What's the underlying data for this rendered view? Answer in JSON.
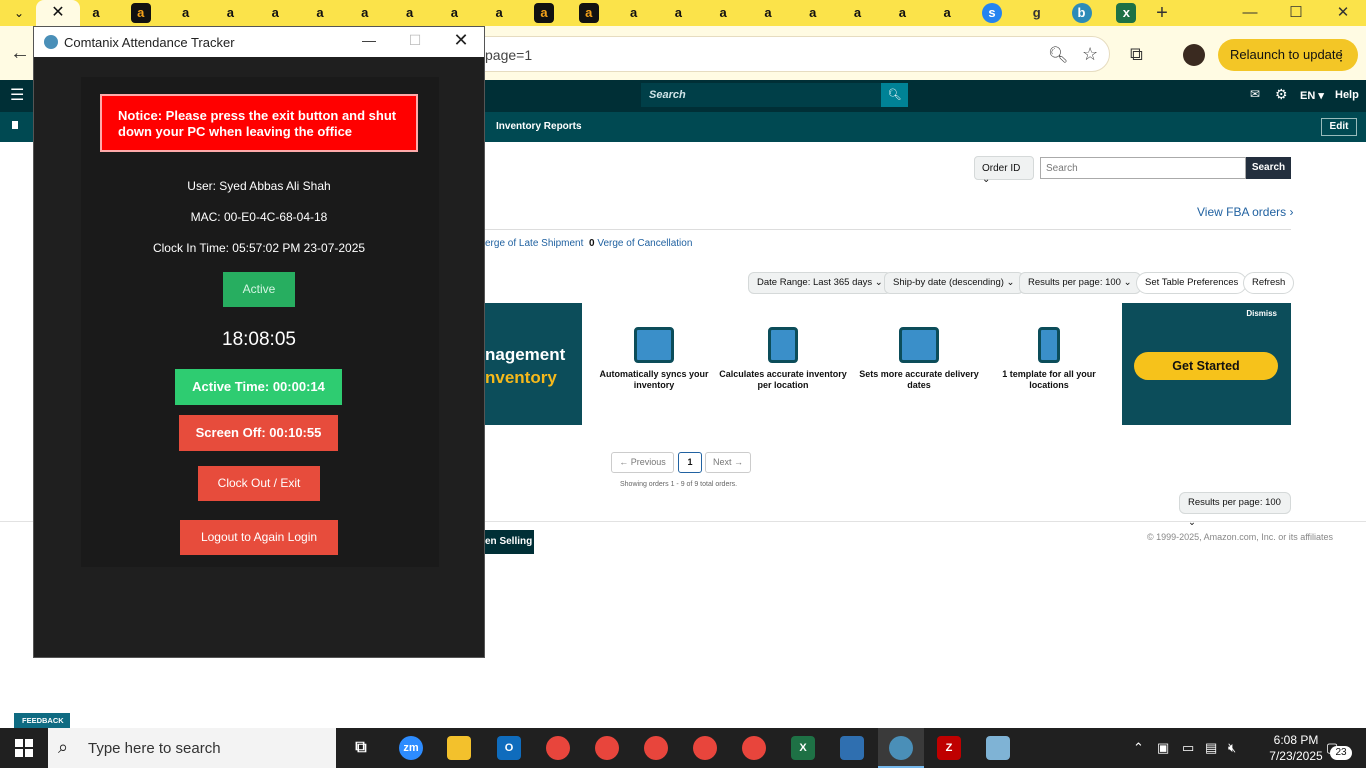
{
  "browser": {
    "tab_dropdown": "⌄",
    "active_tab_close": "✕",
    "tab_icons": [
      "a",
      "a",
      "a",
      "a",
      "a",
      "a",
      "a",
      "a",
      "a",
      "a",
      "a",
      "a",
      "a",
      "a",
      "a",
      "a",
      "a",
      "a",
      "a",
      "a",
      "s",
      "g",
      "b",
      "x"
    ],
    "new_tab": "+",
    "url_fragment": "page=1",
    "relaunch_label": "Relaunch to update",
    "window_controls": {
      "minimize": "—",
      "maximize": "☐",
      "close": "✕"
    }
  },
  "seller_central": {
    "search_placeholder": "Search",
    "lang": "EN ▾",
    "help": "Help",
    "subnav_item": "Inventory Reports",
    "edit": "Edit",
    "order_id_select": "Order ID ⌄",
    "order_search_placeholder": "Search",
    "order_search_button": "Search",
    "view_fba_orders": "View FBA orders ›",
    "late_shipment": "erge of Late Shipment",
    "cancellation_count": "0",
    "cancellation_label": " Verge of Cancellation",
    "filters": {
      "date_range": "Date Range: Last 365 days ⌄",
      "sort": "Ship-by date (descending) ⌄",
      "results_per_page": "Results per page: 100 ⌄",
      "table_prefs": "Set Table Preferences",
      "refresh": "Refresh"
    },
    "banner": {
      "title_line1": "nagement",
      "title_line2": "nventory",
      "features": [
        {
          "text": "Automatically syncs your inventory",
          "icon": "barcode-scanner-icon"
        },
        {
          "text": "Calculates accurate inventory per location",
          "icon": "warehouse-icon"
        },
        {
          "text": "Sets more accurate delivery dates",
          "icon": "calendar-icon"
        },
        {
          "text": "1 template for all your locations",
          "icon": "box-hand-icon"
        }
      ],
      "dismiss": "Dismiss",
      "cta": "Get Started"
    },
    "pagination": {
      "previous": "← Previous",
      "current": "1",
      "next": "Next →",
      "info": "Showing orders 1 - 9 of 9 total orders."
    },
    "results_bottom": "Results per page: 100 ⌄",
    "listen_button": "en Selling",
    "copyright": "© 1999-2025, Amazon.com, Inc. or its affiliates",
    "feedback": "FEEDBACK ✕",
    "colors": {
      "nav": "#002f36",
      "subnav": "#004952",
      "link": "#2162a1"
    }
  },
  "tracker": {
    "title": "Comtanix Attendance Tracker",
    "notice": "Notice: Please press the exit button and shut down your PC when leaving the office",
    "user": "User: Syed  Abbas Ali Shah",
    "mac": "MAC: 00-E0-4C-68-04-18",
    "clock_in": "Clock In Time: 05:57:02 PM 23-07-2025",
    "status": "Active",
    "clock": "18:08:05",
    "active_time": "Active Time: 00:00:14",
    "screen_off": "Screen Off: 00:10:55",
    "clock_out_button": "Clock Out / Exit",
    "logout_button": "Logout to Again Login",
    "colors": {
      "notice": "#ff0000",
      "active": "#2ecc71",
      "danger": "#e74c3c"
    }
  },
  "taskbar": {
    "search_placeholder": "Type here to search",
    "time": "6:08 PM",
    "date": "7/23/2025",
    "notification_count": "23",
    "apps": [
      "task-view",
      "zoom",
      "file-explorer",
      "outlook",
      "chrome",
      "chrome",
      "chrome",
      "chrome",
      "chrome",
      "excel",
      "calculator",
      "attendance-tracker",
      "filezilla",
      "notepad"
    ]
  }
}
